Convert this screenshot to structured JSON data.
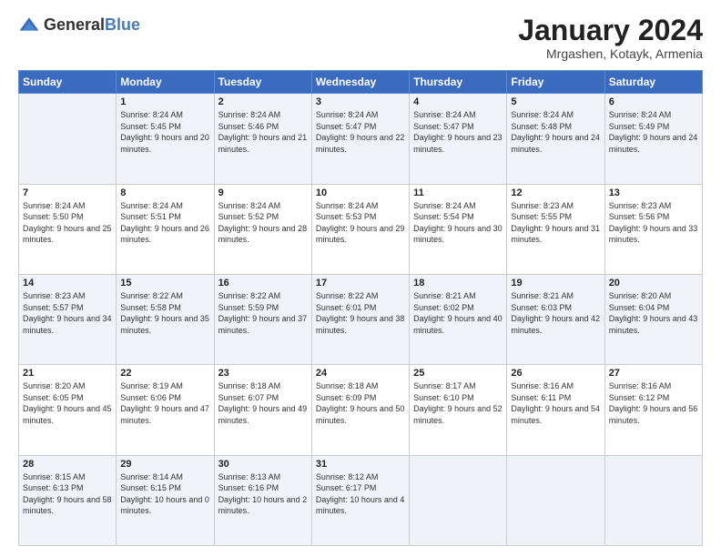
{
  "header": {
    "logo_general": "General",
    "logo_blue": "Blue",
    "title": "January 2024",
    "location": "Mrgashen, Kotayk, Armenia"
  },
  "days_of_week": [
    "Sunday",
    "Monday",
    "Tuesday",
    "Wednesday",
    "Thursday",
    "Friday",
    "Saturday"
  ],
  "weeks": [
    [
      {
        "day": "",
        "sunrise": "",
        "sunset": "",
        "daylight": ""
      },
      {
        "day": "1",
        "sunrise": "Sunrise: 8:24 AM",
        "sunset": "Sunset: 5:45 PM",
        "daylight": "Daylight: 9 hours and 20 minutes."
      },
      {
        "day": "2",
        "sunrise": "Sunrise: 8:24 AM",
        "sunset": "Sunset: 5:46 PM",
        "daylight": "Daylight: 9 hours and 21 minutes."
      },
      {
        "day": "3",
        "sunrise": "Sunrise: 8:24 AM",
        "sunset": "Sunset: 5:47 PM",
        "daylight": "Daylight: 9 hours and 22 minutes."
      },
      {
        "day": "4",
        "sunrise": "Sunrise: 8:24 AM",
        "sunset": "Sunset: 5:47 PM",
        "daylight": "Daylight: 9 hours and 23 minutes."
      },
      {
        "day": "5",
        "sunrise": "Sunrise: 8:24 AM",
        "sunset": "Sunset: 5:48 PM",
        "daylight": "Daylight: 9 hours and 24 minutes."
      },
      {
        "day": "6",
        "sunrise": "Sunrise: 8:24 AM",
        "sunset": "Sunset: 5:49 PM",
        "daylight": "Daylight: 9 hours and 24 minutes."
      }
    ],
    [
      {
        "day": "7",
        "sunrise": "Sunrise: 8:24 AM",
        "sunset": "Sunset: 5:50 PM",
        "daylight": "Daylight: 9 hours and 25 minutes."
      },
      {
        "day": "8",
        "sunrise": "Sunrise: 8:24 AM",
        "sunset": "Sunset: 5:51 PM",
        "daylight": "Daylight: 9 hours and 26 minutes."
      },
      {
        "day": "9",
        "sunrise": "Sunrise: 8:24 AM",
        "sunset": "Sunset: 5:52 PM",
        "daylight": "Daylight: 9 hours and 28 minutes."
      },
      {
        "day": "10",
        "sunrise": "Sunrise: 8:24 AM",
        "sunset": "Sunset: 5:53 PM",
        "daylight": "Daylight: 9 hours and 29 minutes."
      },
      {
        "day": "11",
        "sunrise": "Sunrise: 8:24 AM",
        "sunset": "Sunset: 5:54 PM",
        "daylight": "Daylight: 9 hours and 30 minutes."
      },
      {
        "day": "12",
        "sunrise": "Sunrise: 8:23 AM",
        "sunset": "Sunset: 5:55 PM",
        "daylight": "Daylight: 9 hours and 31 minutes."
      },
      {
        "day": "13",
        "sunrise": "Sunrise: 8:23 AM",
        "sunset": "Sunset: 5:56 PM",
        "daylight": "Daylight: 9 hours and 33 minutes."
      }
    ],
    [
      {
        "day": "14",
        "sunrise": "Sunrise: 8:23 AM",
        "sunset": "Sunset: 5:57 PM",
        "daylight": "Daylight: 9 hours and 34 minutes."
      },
      {
        "day": "15",
        "sunrise": "Sunrise: 8:22 AM",
        "sunset": "Sunset: 5:58 PM",
        "daylight": "Daylight: 9 hours and 35 minutes."
      },
      {
        "day": "16",
        "sunrise": "Sunrise: 8:22 AM",
        "sunset": "Sunset: 5:59 PM",
        "daylight": "Daylight: 9 hours and 37 minutes."
      },
      {
        "day": "17",
        "sunrise": "Sunrise: 8:22 AM",
        "sunset": "Sunset: 6:01 PM",
        "daylight": "Daylight: 9 hours and 38 minutes."
      },
      {
        "day": "18",
        "sunrise": "Sunrise: 8:21 AM",
        "sunset": "Sunset: 6:02 PM",
        "daylight": "Daylight: 9 hours and 40 minutes."
      },
      {
        "day": "19",
        "sunrise": "Sunrise: 8:21 AM",
        "sunset": "Sunset: 6:03 PM",
        "daylight": "Daylight: 9 hours and 42 minutes."
      },
      {
        "day": "20",
        "sunrise": "Sunrise: 8:20 AM",
        "sunset": "Sunset: 6:04 PM",
        "daylight": "Daylight: 9 hours and 43 minutes."
      }
    ],
    [
      {
        "day": "21",
        "sunrise": "Sunrise: 8:20 AM",
        "sunset": "Sunset: 6:05 PM",
        "daylight": "Daylight: 9 hours and 45 minutes."
      },
      {
        "day": "22",
        "sunrise": "Sunrise: 8:19 AM",
        "sunset": "Sunset: 6:06 PM",
        "daylight": "Daylight: 9 hours and 47 minutes."
      },
      {
        "day": "23",
        "sunrise": "Sunrise: 8:18 AM",
        "sunset": "Sunset: 6:07 PM",
        "daylight": "Daylight: 9 hours and 49 minutes."
      },
      {
        "day": "24",
        "sunrise": "Sunrise: 8:18 AM",
        "sunset": "Sunset: 6:09 PM",
        "daylight": "Daylight: 9 hours and 50 minutes."
      },
      {
        "day": "25",
        "sunrise": "Sunrise: 8:17 AM",
        "sunset": "Sunset: 6:10 PM",
        "daylight": "Daylight: 9 hours and 52 minutes."
      },
      {
        "day": "26",
        "sunrise": "Sunrise: 8:16 AM",
        "sunset": "Sunset: 6:11 PM",
        "daylight": "Daylight: 9 hours and 54 minutes."
      },
      {
        "day": "27",
        "sunrise": "Sunrise: 8:16 AM",
        "sunset": "Sunset: 6:12 PM",
        "daylight": "Daylight: 9 hours and 56 minutes."
      }
    ],
    [
      {
        "day": "28",
        "sunrise": "Sunrise: 8:15 AM",
        "sunset": "Sunset: 6:13 PM",
        "daylight": "Daylight: 9 hours and 58 minutes."
      },
      {
        "day": "29",
        "sunrise": "Sunrise: 8:14 AM",
        "sunset": "Sunset: 6:15 PM",
        "daylight": "Daylight: 10 hours and 0 minutes."
      },
      {
        "day": "30",
        "sunrise": "Sunrise: 8:13 AM",
        "sunset": "Sunset: 6:16 PM",
        "daylight": "Daylight: 10 hours and 2 minutes."
      },
      {
        "day": "31",
        "sunrise": "Sunrise: 8:12 AM",
        "sunset": "Sunset: 6:17 PM",
        "daylight": "Daylight: 10 hours and 4 minutes."
      },
      {
        "day": "",
        "sunrise": "",
        "sunset": "",
        "daylight": ""
      },
      {
        "day": "",
        "sunrise": "",
        "sunset": "",
        "daylight": ""
      },
      {
        "day": "",
        "sunrise": "",
        "sunset": "",
        "daylight": ""
      }
    ]
  ]
}
